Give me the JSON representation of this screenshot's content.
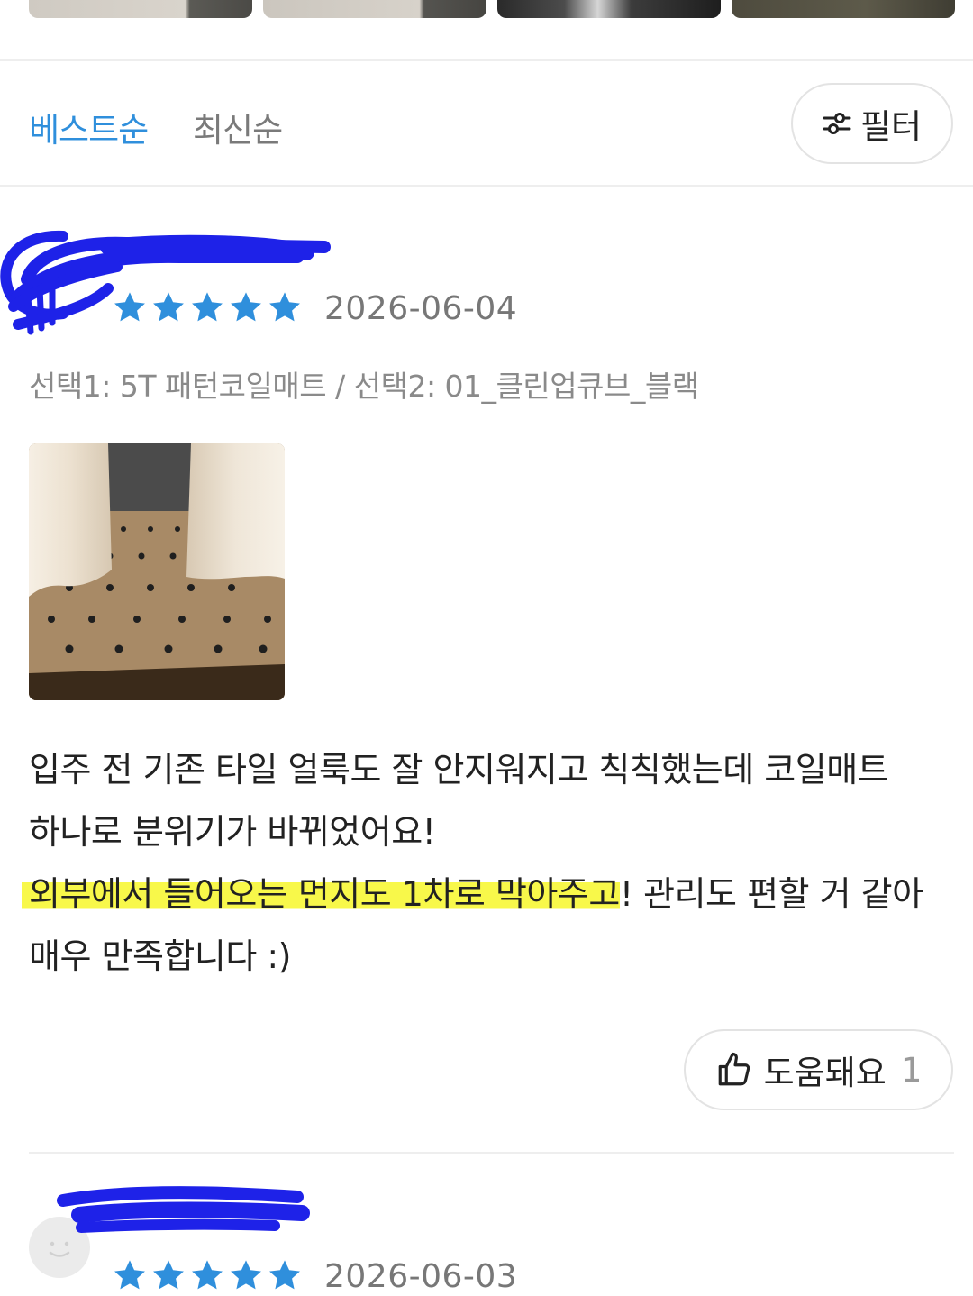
{
  "thumbnails": [
    "photo-thumbnail",
    "photo-thumbnail",
    "photo-thumbnail",
    "photo-thumbnail"
  ],
  "sort": {
    "best_label": "베스트순",
    "recent_label": "최신순",
    "filter_label": "필터",
    "active": "best"
  },
  "colors": {
    "accent": "#2f8fdc",
    "star": "#2f8fdc",
    "highlight": "#f8f84a",
    "redaction": "#1e22e8"
  },
  "reviews": [
    {
      "rating": 5,
      "date": "2026-06-04",
      "option": "선택1: 5T 패턴코일매트 / 선택2: 01_클린업큐브_블랙",
      "text": {
        "line1": "입주 전 기존 타일 얼룩도 잘 안지워지고 칙칙했는데 코일매트",
        "line2": "하나로 분위기가 바뀌었어요!",
        "highlight": "외부에서 들어오는 먼지도 1차로 막아주고",
        "after_highlight": "! 관리도 편할 거 같아",
        "line4": "매우 만족합니다 :)"
      },
      "helpful_label": "도움돼요",
      "helpful_count": "1"
    },
    {
      "rating": 5,
      "date": "2026-06-03"
    }
  ]
}
